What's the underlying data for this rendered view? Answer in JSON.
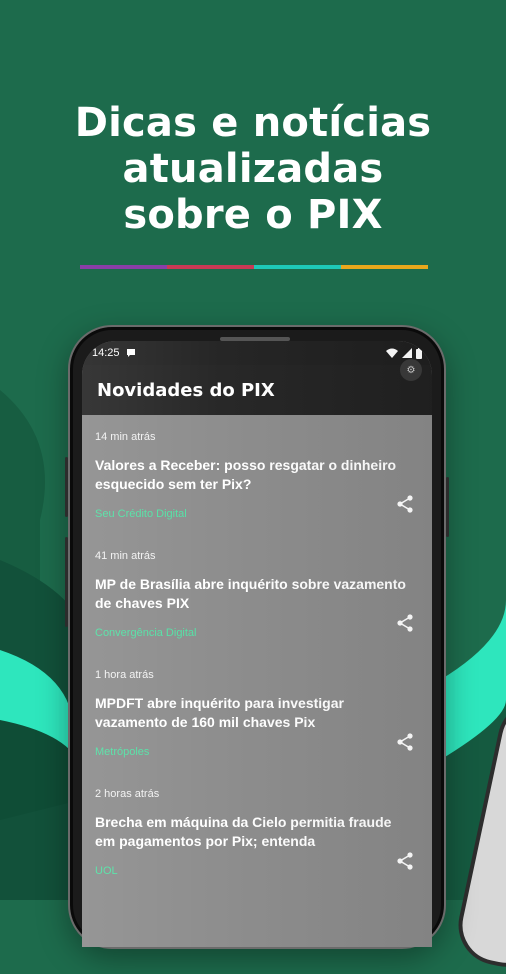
{
  "promo": {
    "line1": "Dicas e notícias",
    "line2": "atualizadas",
    "line3": "sobre o PIX"
  },
  "colors": {
    "background": "#1d6b4c",
    "accent_teal": "#2ee6bd",
    "source_green": "#4ee0a2",
    "divider": [
      "#8a3ea8",
      "#c93a55",
      "#1ec9b8",
      "#e8a81c"
    ]
  },
  "status_bar": {
    "time": "14:25",
    "notification_icon": "chat-bubble-icon",
    "icons": [
      "wifi-icon",
      "signal-icon",
      "battery-icon"
    ]
  },
  "app_bar": {
    "title": "Novidades do PIX",
    "action_icon": "settings-icon"
  },
  "news": [
    {
      "age": "14 min atrás",
      "headline": "Valores a Receber: posso resgatar o dinheiro esquecido sem ter Pix?",
      "source": "Seu Crédito Digital"
    },
    {
      "age": "41 min atrás",
      "headline": "MP de Brasília abre inquérito sobre vazamento de chaves PIX",
      "source": "Convergência Digital"
    },
    {
      "age": "1 hora atrás",
      "headline": "MPDFT abre inquérito para investigar vazamento de 160 mil chaves Pix",
      "source": "Metrópoles"
    },
    {
      "age": "2 horas atrás",
      "headline": "Brecha em máquina da Cielo permitia fraude em pagamentos por Pix; entenda",
      "source": "UOL"
    }
  ]
}
